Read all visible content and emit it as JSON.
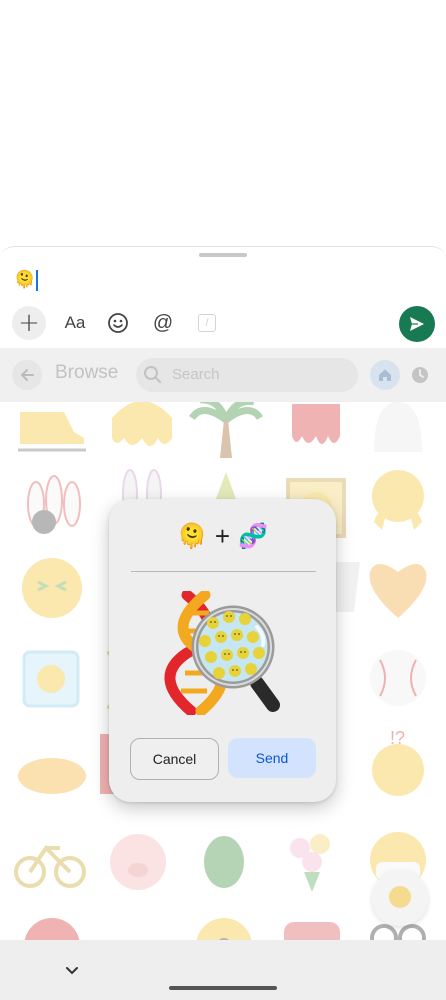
{
  "compose": {
    "message_text": "🫠",
    "tools": {
      "add": "+",
      "format": "Aa",
      "emoji_icon": "smile-icon",
      "mention": "@",
      "slash_icon": "slash-command-icon"
    },
    "send_icon": "send-icon",
    "send_color": "#187a52"
  },
  "browse": {
    "title": "Browse",
    "search_placeholder": "Search",
    "back_icon": "arrow-left-icon",
    "home_icon": "home-icon",
    "recent_icon": "clock-icon"
  },
  "dialog": {
    "left_emoji": "🫠",
    "plus": "+",
    "right_emoji": "🧬",
    "result_icon": "melting-face-dna-magnifier-sticker",
    "cancel_label": "Cancel",
    "send_label": "Send",
    "send_color": "#0b57d0",
    "send_bg": "#d3e3fd"
  },
  "nav": {
    "collapse_icon": "chevron-down-icon"
  }
}
